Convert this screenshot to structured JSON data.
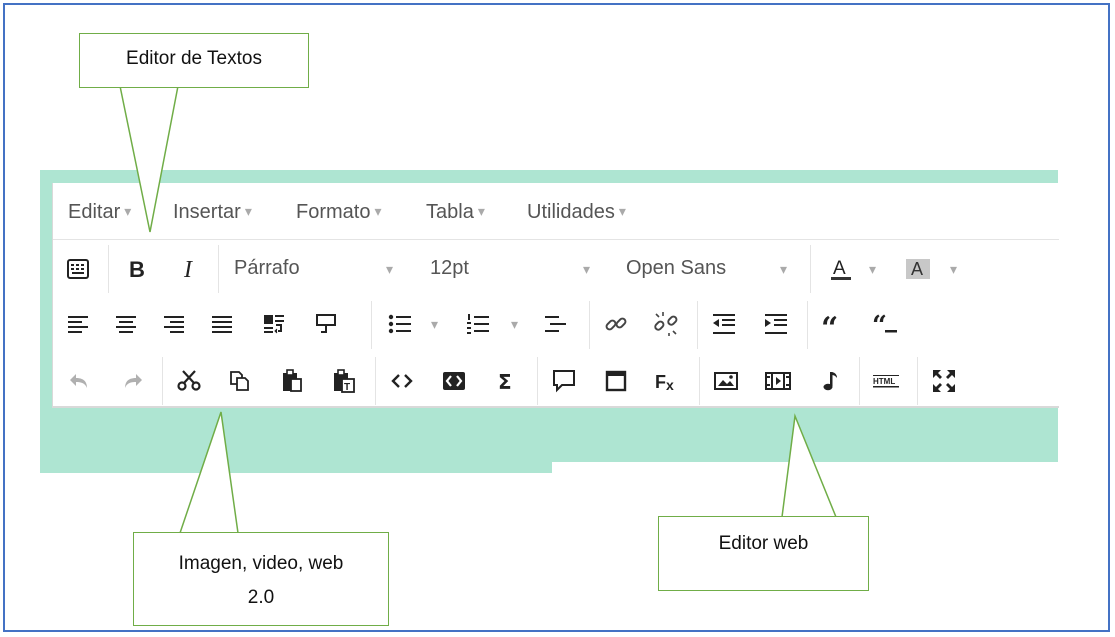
{
  "menu": [
    {
      "label": "Editar"
    },
    {
      "label": "Insertar"
    },
    {
      "label": "Formato"
    },
    {
      "label": "Tabla"
    },
    {
      "label": "Utilidades"
    }
  ],
  "toolbar": {
    "format_value": "Párrafo",
    "size_value": "12pt",
    "font_value": "Open Sans",
    "font_color_glyph": "A",
    "bg_color_glyph": "A"
  },
  "callouts": {
    "editor_textos": "Editor de Textos",
    "imagen_video_line1": "Imagen, video, web",
    "imagen_video_line2": "2.0",
    "editor_web": "Editor web"
  },
  "colors": {
    "frame": "#4472c4",
    "callout_border": "#70ad47",
    "editor_band": "#aee5d2"
  }
}
